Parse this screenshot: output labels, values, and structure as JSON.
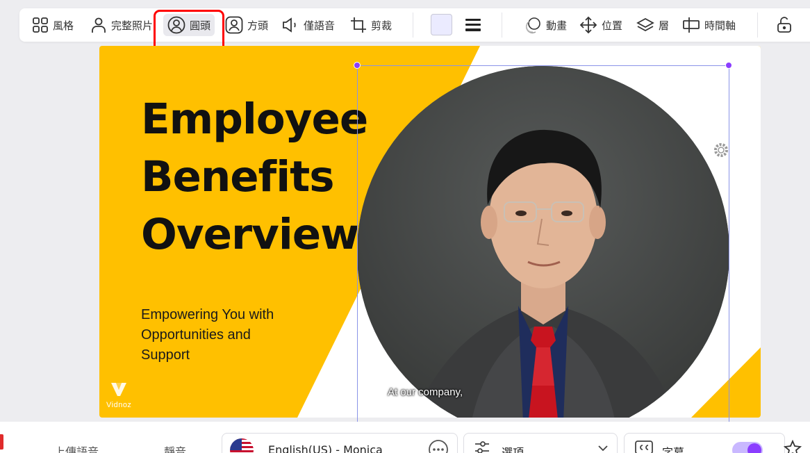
{
  "toolbar": {
    "style_label": "風格",
    "full_photo_label": "完整照片",
    "circle_head_label": "圓頭",
    "square_head_label": "方頭",
    "voice_only_label": "僅語音",
    "crop_label": "剪裁",
    "animation_label": "動畫",
    "position_label": "位置",
    "layer_label": "層",
    "timeline_label": "時間軸",
    "swatch_color": "#ebebff",
    "active_item": "circle_head"
  },
  "slide": {
    "title": "Employee\nBenefits\nOverview",
    "subtitle": "Empowering You with\nOpportunities and\nSupport",
    "brand": "Vidnoz",
    "caption": "At our company,",
    "background_color": "#ffc000",
    "accent_color": "#ffffff"
  },
  "bottom": {
    "upload_voice_label": "上傳語音",
    "mute_label": "靜音",
    "voice_name": "English(US) - Monica",
    "options_label": "選項",
    "subtitles_label": "字幕",
    "subtitles_on": true,
    "accent_color": "#8b3dff"
  }
}
